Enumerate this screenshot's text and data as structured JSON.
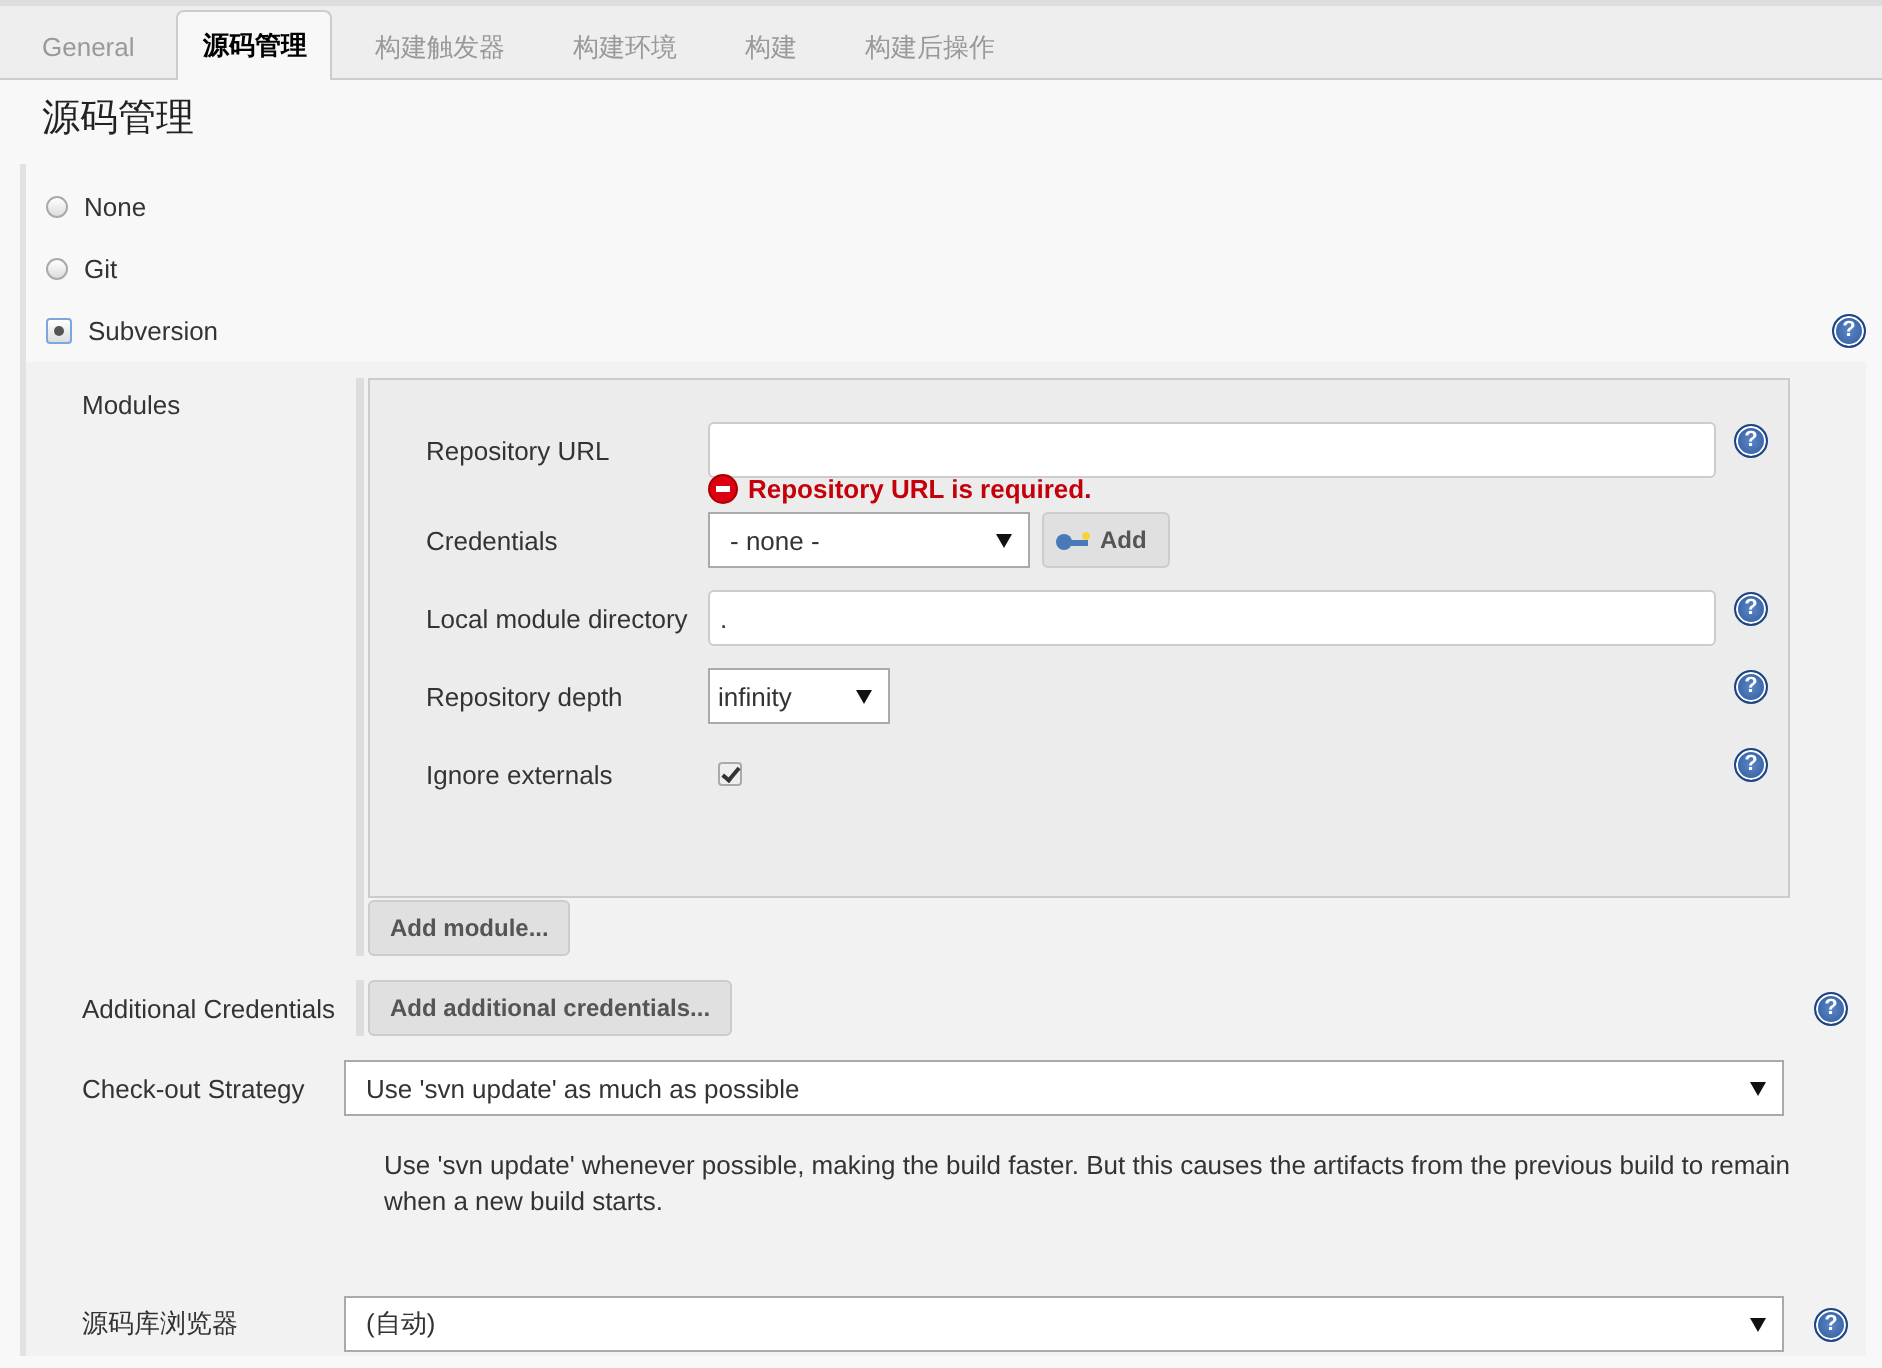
{
  "tabs": [
    {
      "label": "General",
      "selected": false
    },
    {
      "label": "源码管理",
      "selected": true
    },
    {
      "label": "构建触发器",
      "selected": false
    },
    {
      "label": "构建环境",
      "selected": false
    },
    {
      "label": "构建",
      "selected": false
    },
    {
      "label": "构建后操作",
      "selected": false
    }
  ],
  "section_title": "源码管理",
  "scm_options": [
    {
      "label": "None",
      "selected": false
    },
    {
      "label": "Git",
      "selected": false
    },
    {
      "label": "Subversion",
      "selected": true,
      "help": "?"
    }
  ],
  "modules": {
    "label": "Modules",
    "fields": [
      {
        "kind": "text",
        "label": "Repository URL",
        "help": "?",
        "error": "Repository URL is required."
      },
      {
        "kind": "select",
        "label": "Credentials",
        "value": "- none -",
        "button": "Add"
      },
      {
        "kind": "text",
        "label": "Local module directory",
        "value": ".",
        "help": "?"
      },
      {
        "kind": "select",
        "label": "Repository depth",
        "value": "infinity",
        "help": "?"
      },
      {
        "kind": "checkbox",
        "label": "Ignore externals",
        "checked": true,
        "help": "?"
      }
    ],
    "add_button": "Add module..."
  },
  "additional_credentials": {
    "label": "Additional Credentials",
    "button": "Add additional credentials...",
    "help": "?"
  },
  "checkout_strategy": {
    "label": "Check-out Strategy",
    "value": "Use 'svn update' as much as possible",
    "description": "Use 'svn update' whenever possible, making the build faster. But this causes the artifacts from the previous build to remain when a new build starts."
  },
  "repository_browser": {
    "label": "源码库浏览器",
    "value": "(自动)",
    "help": "?"
  }
}
